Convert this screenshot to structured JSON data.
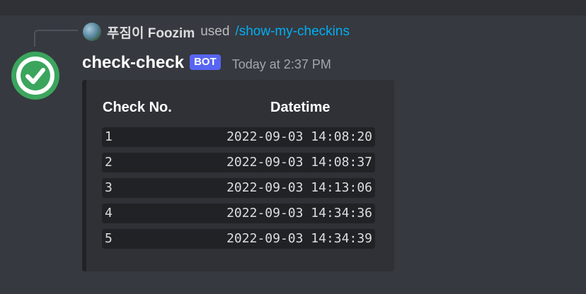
{
  "reply": {
    "user": "푸짐이 Foozim",
    "used_text": "used",
    "command": "/show-my-checkins"
  },
  "message": {
    "username": "check-check",
    "bot_tag": "BOT",
    "timestamp": "Today at 2:37 PM"
  },
  "table": {
    "headers": [
      "Check No.",
      "Datetime"
    ],
    "rows": [
      {
        "no": "1",
        "datetime": "2022-09-03 14:08:20"
      },
      {
        "no": "2",
        "datetime": "2022-09-03 14:08:37"
      },
      {
        "no": "3",
        "datetime": "2022-09-03 14:13:06"
      },
      {
        "no": "4",
        "datetime": "2022-09-03 14:34:36"
      },
      {
        "no": "5",
        "datetime": "2022-09-03 14:34:39"
      }
    ]
  },
  "icons": {
    "avatar": "check-circle-icon",
    "reply_avatar": "user-avatar"
  },
  "colors": {
    "background": "#36393f",
    "embed": "#2f3136",
    "accent_bot": "#5865f2",
    "command_link": "#00aff4",
    "avatar_green": "#3ba55d"
  }
}
